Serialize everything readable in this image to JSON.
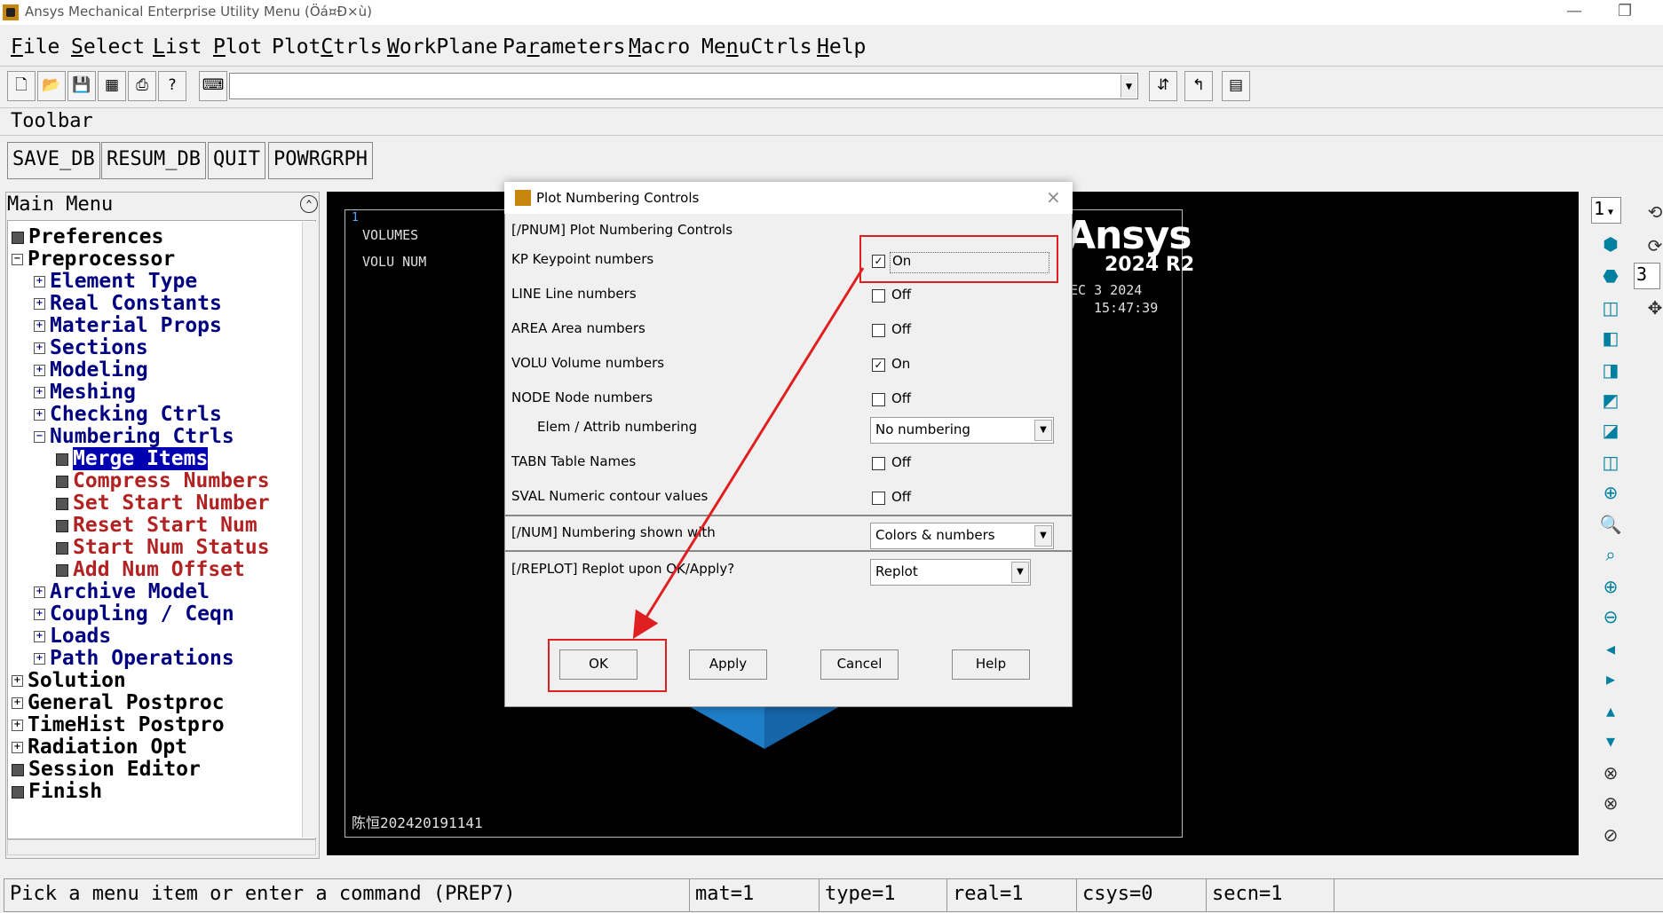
{
  "window": {
    "title": "Ansys Mechanical Enterprise Utility Menu (Öá¤Ð×ù)",
    "minimize": "—",
    "restore": "❐"
  },
  "menubar": [
    {
      "label": "File",
      "u": "F",
      "rest": "ile"
    },
    {
      "label": "Select",
      "u": "S",
      "rest": "elect"
    },
    {
      "label": "List",
      "u": "L",
      "rest": "ist"
    },
    {
      "label": "Plot",
      "u": "P",
      "rest": "lot"
    },
    {
      "label": "PlotCtrls",
      "pre": "Plot",
      "u": "C",
      "rest": "trls"
    },
    {
      "label": "WorkPlane",
      "u": "W",
      "rest": "orkPlane"
    },
    {
      "label": "Parameters",
      "pre": "Pa",
      "u": "r",
      "rest": "ameters"
    },
    {
      "label": "Macro",
      "u": "M",
      "rest": "acro"
    },
    {
      "label": "MenuCtrls",
      "pre": "Me",
      "u": "n",
      "rest": "uCtrls"
    },
    {
      "label": "Help",
      "u": "H",
      "rest": "elp"
    }
  ],
  "toolbar": {
    "label": "Toolbar",
    "buttons": [
      "SAVE_DB",
      "RESUM_DB",
      "QUIT",
      "POWRGRPH"
    ]
  },
  "main_menu": {
    "header": "Main Menu",
    "items": [
      {
        "label": "Preferences",
        "level": 0,
        "icon": "cmd",
        "color": "black"
      },
      {
        "label": "Preprocessor",
        "level": 0,
        "icon": "minus",
        "color": "black"
      },
      {
        "label": "Element Type",
        "level": 1,
        "icon": "plus",
        "color": "blue"
      },
      {
        "label": "Real Constants",
        "level": 1,
        "icon": "plus",
        "color": "blue"
      },
      {
        "label": "Material Props",
        "level": 1,
        "icon": "plus",
        "color": "blue"
      },
      {
        "label": "Sections",
        "level": 1,
        "icon": "plus",
        "color": "blue"
      },
      {
        "label": "Modeling",
        "level": 1,
        "icon": "plus",
        "color": "blue"
      },
      {
        "label": "Meshing",
        "level": 1,
        "icon": "plus",
        "color": "blue"
      },
      {
        "label": "Checking Ctrls",
        "level": 1,
        "icon": "plus",
        "color": "blue"
      },
      {
        "label": "Numbering Ctrls",
        "level": 1,
        "icon": "minus",
        "color": "blue"
      },
      {
        "label": "Merge Items",
        "level": 2,
        "icon": "cmd",
        "color": "red",
        "selected": true
      },
      {
        "label": "Compress Numbers",
        "level": 2,
        "icon": "cmd",
        "color": "red"
      },
      {
        "label": "Set Start Number",
        "level": 2,
        "icon": "cmd",
        "color": "red"
      },
      {
        "label": "Reset Start Num",
        "level": 2,
        "icon": "cmd",
        "color": "red"
      },
      {
        "label": "Start Num Status",
        "level": 2,
        "icon": "cmd",
        "color": "red"
      },
      {
        "label": "Add Num Offset",
        "level": 2,
        "icon": "cmd",
        "color": "red"
      },
      {
        "label": "Archive Model",
        "level": 1,
        "icon": "plus",
        "color": "blue"
      },
      {
        "label": "Coupling / Ceqn",
        "level": 1,
        "icon": "plus",
        "color": "blue"
      },
      {
        "label": "Loads",
        "level": 1,
        "icon": "plus",
        "color": "blue"
      },
      {
        "label": "Path Operations",
        "level": 1,
        "icon": "plus",
        "color": "blue"
      },
      {
        "label": "Solution",
        "level": 0,
        "icon": "plus",
        "color": "black"
      },
      {
        "label": "General Postproc",
        "level": 0,
        "icon": "plus",
        "color": "black"
      },
      {
        "label": "TimeHist Postpro",
        "level": 0,
        "icon": "plus",
        "color": "black"
      },
      {
        "label": "Radiation Opt",
        "level": 0,
        "icon": "plus",
        "color": "black"
      },
      {
        "label": "Session Editor",
        "level": 0,
        "icon": "cmd",
        "color": "black"
      },
      {
        "label": "Finish",
        "level": 0,
        "icon": "cmd",
        "color": "black"
      }
    ]
  },
  "graphics": {
    "window_number": "1",
    "line1": "VOLUMES",
    "line2": "VOLU NUM",
    "logo": "Ansys",
    "version": "2024 R2",
    "date": "DEC  3 2024",
    "time": "15:47:39",
    "footer": "陈恒202420191141"
  },
  "right_toolbar": {
    "window_select": "1",
    "window_select_2": "3"
  },
  "dialog": {
    "title": "Plot Numbering Controls",
    "close": "×",
    "heading": "[/PNUM]  Plot Numbering Controls",
    "rows": [
      {
        "label": "KP     Keypoint numbers",
        "checked": true,
        "state": "On"
      },
      {
        "label": "LINE  Line numbers",
        "checked": false,
        "state": "Off"
      },
      {
        "label": "AREA  Area numbers",
        "checked": false,
        "state": "Off"
      },
      {
        "label": "VOLU  Volume numbers",
        "checked": true,
        "state": "On"
      },
      {
        "label": "NODE  Node numbers",
        "checked": false,
        "state": "Off"
      }
    ],
    "elem_label": "Elem / Attrib numbering",
    "elem_value": "No numbering",
    "rows2": [
      {
        "label": "TABN  Table Names",
        "checked": false,
        "state": "Off"
      },
      {
        "label": "SVAL  Numeric contour values",
        "checked": false,
        "state": "Off"
      }
    ],
    "num_label": "[/NUM]  Numbering shown with",
    "num_value": "Colors & numbers",
    "replot_label": "[/REPLOT] Replot upon OK/Apply?",
    "replot_value": "Replot",
    "buttons": {
      "ok": "OK",
      "apply": "Apply",
      "cancel": "Cancel",
      "help": "Help"
    }
  },
  "statusbar": {
    "prompt": "Pick a menu item or enter a command (PREP7)",
    "mat": "mat=1",
    "type": "type=1",
    "real": "real=1",
    "csys": "csys=0",
    "secn": "secn=1"
  },
  "colors": {
    "annotation": "#e02020",
    "tree_blue": "#000080",
    "tree_red": "#b22222",
    "selection": "#0000b0"
  }
}
